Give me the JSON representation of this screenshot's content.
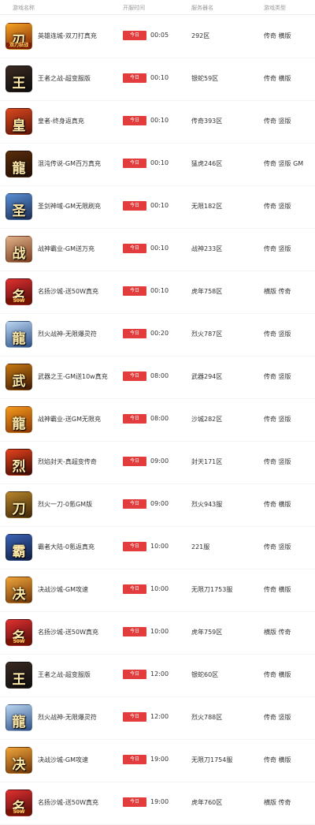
{
  "header": {
    "name": "游戏名称",
    "time": "开服时间",
    "server": "服务器名",
    "type": "游戏类型"
  },
  "today_label": "今日",
  "rows": [
    {
      "name": "英雄连城-双刀打真充",
      "time": "00:05",
      "server": "292区",
      "type": "传奇 横版",
      "icon": "game-icon-warrior",
      "glyph": "刃",
      "badge": "双刀狂战",
      "color_top": "#f6a623",
      "color_bottom": "#7a1f06"
    },
    {
      "name": "王者之战-超变服版",
      "time": "00:10",
      "server": "银蛇59区",
      "type": "传奇 横版",
      "icon": "game-icon-king",
      "glyph": "王",
      "badge": "",
      "color_top": "#3a2a22",
      "color_bottom": "#0d0d0d"
    },
    {
      "name": "皇者-终身返真充",
      "time": "00:10",
      "server": "传奇393区",
      "type": "传奇 竖版",
      "icon": "game-icon-sword",
      "glyph": "皇",
      "badge": "",
      "color_top": "#d9481f",
      "color_bottom": "#5b1408"
    },
    {
      "name": "混沌传说-GM百万真充",
      "time": "00:10",
      "server": "猛虎246区",
      "type": "传奇 竖版 GM",
      "icon": "game-icon-dragon-gold",
      "glyph": "龍",
      "badge": "",
      "color_top": "#5a2d0c",
      "color_bottom": "#1e0c03"
    },
    {
      "name": "圣剑神域-GM无限刷充",
      "time": "00:10",
      "server": "无限182区",
      "type": "传奇 竖版",
      "icon": "game-icon-knight",
      "glyph": "圣",
      "badge": "",
      "color_top": "#5a8fd6",
      "color_bottom": "#1c2d52"
    },
    {
      "name": "战神霸业-GM送万充",
      "time": "00:10",
      "server": "战神233区",
      "type": "传奇 竖版",
      "icon": "game-icon-warlord",
      "glyph": "战",
      "badge": "",
      "color_top": "#e0b28a",
      "color_bottom": "#7a3b1d"
    },
    {
      "name": "名扬沙城-送50W真充",
      "time": "00:10",
      "server": "虎年758区",
      "type": "横版 传奇",
      "icon": "game-icon-orb",
      "glyph": "名",
      "badge": "50W",
      "color_top": "#e23030",
      "color_bottom": "#4a0a0a"
    },
    {
      "name": "烈火战神-无限爆灵符",
      "time": "00:20",
      "server": "烈火787区",
      "type": "传奇 竖版",
      "icon": "game-icon-dragon-blue",
      "glyph": "龍",
      "badge": "",
      "color_top": "#bcd6f2",
      "color_bottom": "#2b4f86"
    },
    {
      "name": "武器之王-GM送10w真充",
      "time": "08:00",
      "server": "武器294区",
      "type": "传奇 竖版",
      "icon": "game-icon-blade",
      "glyph": "武",
      "badge": "",
      "color_top": "#c77a12",
      "color_bottom": "#3d1704"
    },
    {
      "name": "战神霸业-送GM无限充",
      "time": "08:00",
      "server": "沙城282区",
      "type": "传奇 竖版",
      "icon": "game-icon-dragon-orange",
      "glyph": "龍",
      "badge": "",
      "color_top": "#f39a1c",
      "color_bottom": "#8a3605"
    },
    {
      "name": "烈焰封天-真超变传奇",
      "time": "09:00",
      "server": "封天171区",
      "type": "传奇 竖版",
      "icon": "game-icon-flame",
      "glyph": "烈",
      "badge": "",
      "color_top": "#e5431c",
      "color_bottom": "#3a0a04"
    },
    {
      "name": "烈火一刀-0氪GM版",
      "time": "09:00",
      "server": "烈火943服",
      "type": "传奇 横版",
      "icon": "game-icon-saber",
      "glyph": "刀",
      "badge": "",
      "color_top": "#b8862c",
      "color_bottom": "#3d2508"
    },
    {
      "name": "霸者大陆-0氪返真充",
      "time": "10:00",
      "server": "221服",
      "type": "传奇 竖版",
      "icon": "game-icon-overlord",
      "glyph": "霸",
      "badge": "",
      "color_top": "#3b63b5",
      "color_bottom": "#0e1c3f"
    },
    {
      "name": "决战沙城-GM攻速",
      "time": "10:00",
      "server": "无限刀1753服",
      "type": "传奇 横版",
      "icon": "game-icon-battle",
      "glyph": "决",
      "badge": "",
      "color_top": "#f0a53a",
      "color_bottom": "#6a3208"
    },
    {
      "name": "名扬沙城-送50W真充",
      "time": "10:00",
      "server": "虎年759区",
      "type": "横版 传奇",
      "icon": "game-icon-orb",
      "glyph": "名",
      "badge": "50W",
      "color_top": "#e23030",
      "color_bottom": "#4a0a0a"
    },
    {
      "name": "王者之战-超变服版",
      "time": "12:00",
      "server": "银蛇60区",
      "type": "传奇 横版",
      "icon": "game-icon-king",
      "glyph": "王",
      "badge": "",
      "color_top": "#3a2a22",
      "color_bottom": "#0d0d0d"
    },
    {
      "name": "烈火战神-无限爆灵符",
      "time": "12:00",
      "server": "烈火788区",
      "type": "传奇 竖版",
      "icon": "game-icon-dragon-blue",
      "glyph": "龍",
      "badge": "",
      "color_top": "#bcd6f2",
      "color_bottom": "#2b4f86"
    },
    {
      "name": "决战沙城-GM攻速",
      "time": "19:00",
      "server": "无限刀1754服",
      "type": "传奇 横版",
      "icon": "game-icon-battle",
      "glyph": "决",
      "badge": "",
      "color_top": "#f0a53a",
      "color_bottom": "#6a3208"
    },
    {
      "name": "名扬沙城-送50W真充",
      "time": "19:00",
      "server": "虎年760区",
      "type": "横版 传奇",
      "icon": "game-icon-orb",
      "glyph": "名",
      "badge": "50W",
      "color_top": "#e23030",
      "color_bottom": "#4a0a0a"
    }
  ],
  "colors": {
    "today_badge": "#e23c3c",
    "header_text": "#999999",
    "row_text": "#333333"
  }
}
